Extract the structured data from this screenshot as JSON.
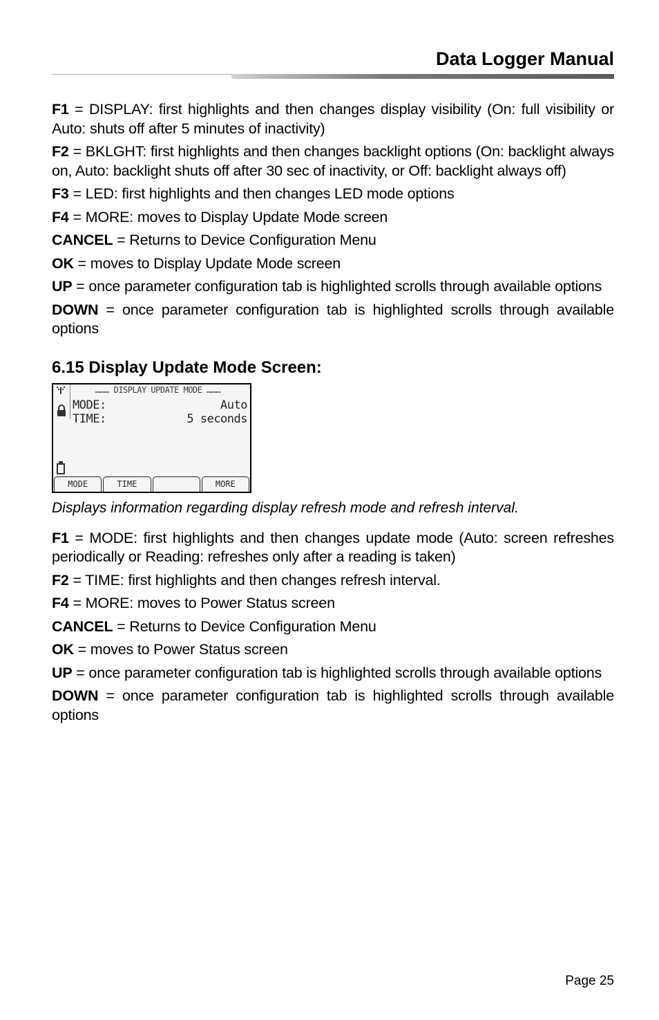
{
  "header": {
    "title": "Data Logger Manual"
  },
  "block1": {
    "f1_label": "F1",
    "f1_text": " = DISPLAY: first highlights and then changes display visibility (On: full visibility or Auto: shuts off after 5 minutes of inactivity)",
    "f2_label": "F2",
    "f2_text": " = BKLGHT: first highlights and then changes backlight options (On: backlight always on, Auto: backlight shuts off after 30 sec of inactivity, or Off: backlight always off)",
    "f3_label": "F3",
    "f3_text": " = LED: first highlights and then changes LED mode options",
    "f4_label": "F4",
    "f4_text": " = MORE: moves to Display Update Mode screen",
    "cancel_label": "CANCEL",
    "cancel_text": " = Returns to Device Configuration Menu",
    "ok_label": "OK",
    "ok_text": " = moves to Display Update Mode screen",
    "up_label": "UP",
    "up_text": " = once parameter configuration tab is highlighted scrolls through available options",
    "down_label": "DOWN",
    "down_text": " = once parameter configuration tab is highlighted scrolls through available options"
  },
  "section": {
    "heading": "6.15 Display Update Mode Screen:"
  },
  "lcd": {
    "title": "……… DISPLAY UPDATE MODE ………",
    "rows": [
      {
        "label": "MODE:",
        "value": "Auto"
      },
      {
        "label": "TIME:",
        "value": "5 seconds"
      }
    ],
    "softkeys": [
      "MODE",
      "TIME",
      "",
      "MORE"
    ]
  },
  "caption": "Displays information regarding display refresh mode and refresh interval.",
  "block2": {
    "f1_label": "F1",
    "f1_text": " = MODE: first highlights and then changes update mode (Auto: screen refreshes periodically or Reading: refreshes only after a reading is taken)",
    "f2_label": "F2",
    "f2_text": " = TIME: first highlights and then changes refresh interval.",
    "f4_label": "F4",
    "f4_text": " = MORE: moves to Power Status screen",
    "cancel_label": "CANCEL",
    "cancel_text": " = Returns to Device Configuration Menu",
    "ok_label": "OK",
    "ok_text": " = moves to Power Status screen",
    "up_label": "UP",
    "up_text": " = once parameter configuration tab is highlighted scrolls through available options",
    "down_label": "DOWN",
    "down_text": " = once parameter configuration tab is highlighted scrolls through available options"
  },
  "footer": {
    "page": "Page 25"
  }
}
